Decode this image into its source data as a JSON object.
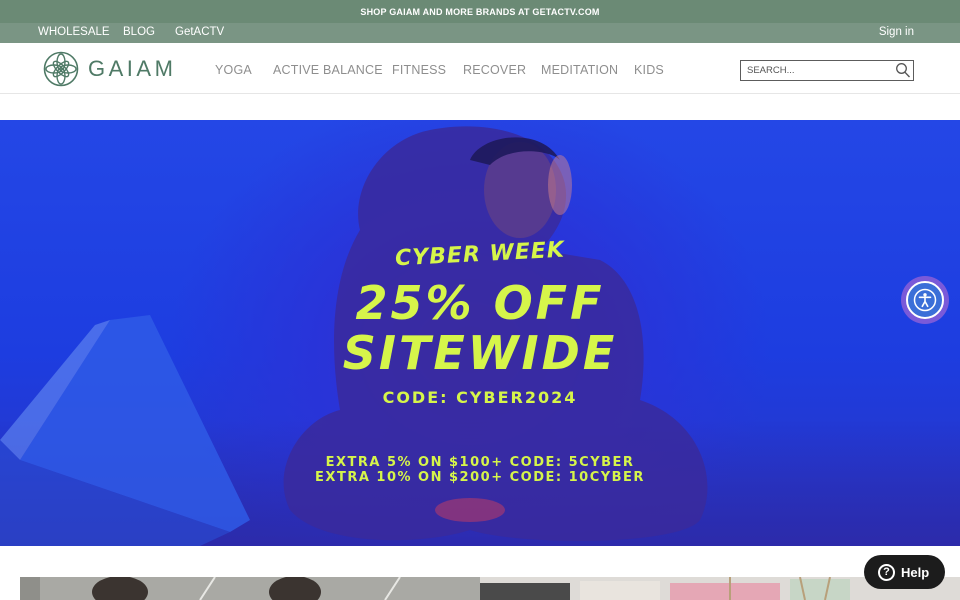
{
  "promo": {
    "text": "SHOP GAIAM AND MORE BRANDS AT GETACTV.COM"
  },
  "utility": {
    "links": [
      "WHOLESALE",
      "BLOG",
      "GetACTV"
    ],
    "sign_in": "Sign in"
  },
  "header": {
    "logo_text": "GAIAM",
    "nav": [
      "YOGA",
      "ACTIVE BALANCE",
      "FITNESS",
      "RECOVER",
      "MEDITATION",
      "KIDS"
    ],
    "search_placeholder": "SEARCH..."
  },
  "hero": {
    "eyebrow": "CYBER WEEK",
    "headline_1": "25% OFF",
    "headline_2": "SITEWIDE",
    "code": "CODE: CYBER2024",
    "extra_1": "EXTRA 5% ON $100+ CODE: 5CYBER",
    "extra_2": "EXTRA 10% ON $200+ CODE: 10CYBER"
  },
  "help": {
    "label": "Help",
    "icon": "question-icon"
  },
  "accessibility": {
    "icon": "accessibility-icon"
  },
  "colors": {
    "promo_bar": "#6b8a75",
    "utility_bar": "#7a9584",
    "brand_green": "#4f7a66",
    "hero_accent": "#d6f54a",
    "hero_blue": "#2447e6"
  }
}
